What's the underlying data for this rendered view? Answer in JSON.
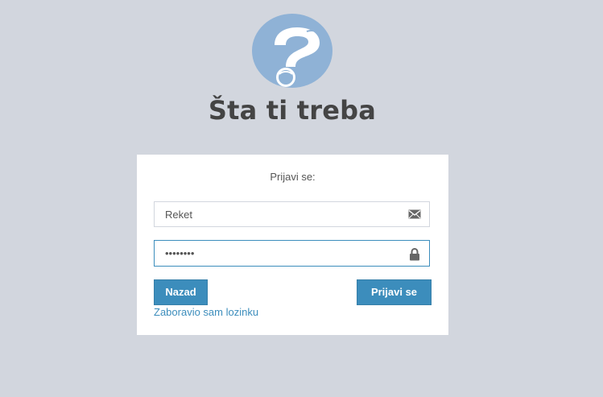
{
  "app": {
    "title": "Šta ti treba",
    "logo_icon": "question-mark-logo-icon"
  },
  "login": {
    "heading": "Prijavi se:",
    "email": {
      "value": "Reket",
      "icon": "envelope-icon"
    },
    "password": {
      "value": "••••••••",
      "icon": "lock-icon"
    },
    "back_label": "Nazad",
    "submit_label": "Prijavi se",
    "forgot_label": "Zaboravio sam lozinku"
  },
  "colors": {
    "background": "#d2d6de",
    "accent": "#3c8dbc",
    "logo": "#8fb2d6",
    "title": "#444444"
  }
}
